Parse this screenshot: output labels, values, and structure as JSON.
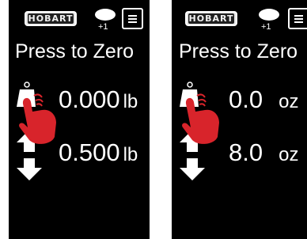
{
  "panels": [
    {
      "logo": "HOBART",
      "badge_text": "+1",
      "zero_label": "Press to Zero",
      "tare_value": "0.000",
      "tare_unit": "lb",
      "target_value": "0.500",
      "target_unit": "lb"
    },
    {
      "logo": "HOBART",
      "badge_text": "+1",
      "zero_label": "Press to Zero",
      "tare_value": "0.0",
      "tare_unit": "oz",
      "target_value": "8.0",
      "target_unit": "oz"
    }
  ],
  "icons": [
    "menu-icon",
    "tare-icon",
    "hand-pointer-icon",
    "up-arrow-icon",
    "down-arrow-icon"
  ],
  "colors": {
    "accent": "#d8242b",
    "background": "#000000",
    "text": "#ffffff"
  }
}
